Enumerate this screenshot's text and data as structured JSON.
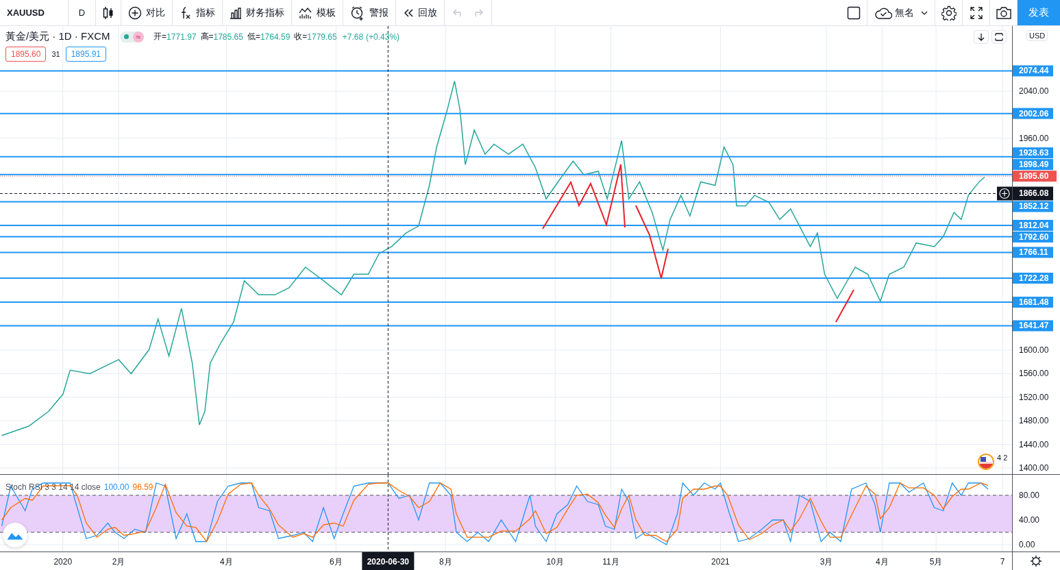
{
  "toolbar": {
    "symbol": "XAUUSD",
    "interval": "D",
    "buttons": [
      {
        "kind": "compare",
        "label": "对比"
      },
      {
        "kind": "indicators",
        "label": "指标"
      },
      {
        "kind": "financials",
        "label": "财务指标"
      },
      {
        "kind": "templates",
        "label": "模板"
      },
      {
        "kind": "alert",
        "label": "警报"
      },
      {
        "kind": "replay",
        "label": "回放"
      }
    ],
    "history_buttons": [
      {
        "kind": "undo",
        "disabled": true
      },
      {
        "kind": "redo",
        "disabled": true
      }
    ],
    "layout_name": "無名",
    "publish_label": "发表"
  },
  "legend": {
    "title": "黃金/美元 · 1D · FXCM",
    "market_open": true,
    "badge": "≈",
    "ohlc": [
      {
        "key": "开=",
        "value": "1771.97"
      },
      {
        "key": "高=",
        "value": "1785.65"
      },
      {
        "key": "低=",
        "value": "1764.59"
      },
      {
        "key": "收=",
        "value": "1779.65"
      }
    ],
    "change": "+7.68",
    "change_pct": "(+0.43%)",
    "bid": "1895.60",
    "spread": "31",
    "ask": "1895.91"
  },
  "currency": "USD",
  "event_marker": {
    "label": "4 2"
  },
  "price_pane": {
    "chart_data": {
      "type": "line",
      "grid": true,
      "xlim": [
        "2019-11-27",
        "2021-07-09"
      ],
      "ylim": [
        1389.5,
        2150.6
      ],
      "ref_lines": [
        {
          "axis": "y",
          "value": 2074.44,
          "label": "2074.44",
          "color": "#2196f3"
        },
        {
          "axis": "y",
          "value": 2002.06,
          "label": "2002.06",
          "color": "#2196f3"
        },
        {
          "axis": "y",
          "value": 1928.63,
          "label": "1928.63",
          "color": "#2196f3"
        },
        {
          "axis": "y",
          "value": 1898.49,
          "label": "1898.49",
          "color": "#2196f3"
        },
        {
          "axis": "y",
          "value": 1852.12,
          "label": "1852.12",
          "color": "#2196f3"
        },
        {
          "axis": "y",
          "value": 1812.04,
          "label": "1812.04",
          "color": "#2196f3"
        },
        {
          "axis": "y",
          "value": 1792.6,
          "label": "1792.60",
          "color": "#2196f3"
        },
        {
          "axis": "y",
          "value": 1766.11,
          "label": "1766.11",
          "color": "#2196f3"
        },
        {
          "axis": "y",
          "value": 1722.28,
          "label": "1722.28",
          "color": "#2196f3"
        },
        {
          "axis": "y",
          "value": 1681.48,
          "label": "1681.48",
          "color": "#2196f3"
        },
        {
          "axis": "y",
          "value": 1641.47,
          "label": "1641.47",
          "color": "#2196f3"
        },
        {
          "axis": "y",
          "value": 1895.6,
          "label": "1895.60",
          "color": "#ef5350"
        },
        {
          "axis": "y",
          "value": 1866.08,
          "label": "1866.08",
          "color": "#131722"
        },
        {
          "axis": "x",
          "value": "2020-06-30",
          "color": "#131722"
        }
      ],
      "x": [
        "2019-11-28",
        "2019-12-13",
        "2019-12-24",
        "2020-01-01",
        "2020-01-05",
        "2020-01-16",
        "2020-02-01",
        "2020-02-08",
        "2020-02-18",
        "2020-02-23",
        "2020-02-29",
        "2020-03-07",
        "2020-03-13",
        "2020-03-17",
        "2020-03-20",
        "2020-03-23",
        "2020-03-29",
        "2020-04-05",
        "2020-04-11",
        "2020-04-19",
        "2020-04-28",
        "2020-05-06",
        "2020-05-15",
        "2020-05-25",
        "2020-06-04",
        "2020-06-11",
        "2020-06-19",
        "2020-06-25",
        "2020-07-02",
        "2020-07-10",
        "2020-07-17",
        "2020-07-23",
        "2020-07-27",
        "2020-08-02",
        "2020-08-06",
        "2020-08-09",
        "2020-08-12",
        "2020-08-17",
        "2020-08-23",
        "2020-08-28",
        "2020-09-05",
        "2020-09-13",
        "2020-09-20",
        "2020-09-26",
        "2020-10-04",
        "2020-10-11",
        "2020-10-17",
        "2020-10-25",
        "2020-10-30",
        "2020-11-07",
        "2020-11-11",
        "2020-11-17",
        "2020-11-24",
        "2020-11-30",
        "2020-12-04",
        "2020-12-10",
        "2020-12-15",
        "2020-12-21",
        "2020-12-29",
        "2021-01-03",
        "2021-01-08",
        "2021-01-10",
        "2021-01-15",
        "2021-01-20",
        "2021-01-28",
        "2021-02-03",
        "2021-02-09",
        "2021-02-14",
        "2021-02-20",
        "2021-02-24",
        "2021-02-28",
        "2021-03-07",
        "2021-03-17",
        "2021-03-24",
        "2021-03-31",
        "2021-04-05",
        "2021-04-13",
        "2021-04-20",
        "2021-04-30",
        "2021-05-05",
        "2021-05-11",
        "2021-05-15",
        "2021-05-19",
        "2021-05-25",
        "2021-05-28"
      ],
      "series": [
        {
          "color": "#26a69a",
          "values": [
            1455,
            1471,
            1496,
            1525,
            1566,
            1560,
            1584,
            1560,
            1601,
            1653,
            1590,
            1671,
            1578,
            1473,
            1496,
            1578,
            1613,
            1648,
            1718,
            1694,
            1694,
            1706,
            1741,
            1718,
            1694,
            1729,
            1729,
            1764,
            1776,
            1799,
            1811,
            1880,
            1945,
            2009,
            2057,
            2009,
            1915,
            1974,
            1933,
            1950,
            1933,
            1950,
            1910,
            1857,
            1892,
            1921,
            1898,
            1904,
            1857,
            1956,
            1857,
            1886,
            1834,
            1770,
            1822,
            1863,
            1828,
            1886,
            1880,
            1945,
            1915,
            1845,
            1845,
            1863,
            1851,
            1822,
            1840,
            1811,
            1776,
            1799,
            1729,
            1688,
            1741,
            1729,
            1683,
            1729,
            1741,
            1782,
            1776,
            1793,
            1834,
            1822,
            1863,
            1886,
            1894
          ]
        }
      ],
      "yticks": [
        {
          "value": 2040,
          "label": "2040.00"
        },
        {
          "value": 1960,
          "label": "1960.00"
        },
        {
          "value": 1600,
          "label": "1600.00"
        },
        {
          "value": 1560,
          "label": "1560.00"
        },
        {
          "value": 1520,
          "label": "1520.00"
        },
        {
          "value": 1480,
          "label": "1480.00"
        },
        {
          "value": 1440,
          "label": "1440.00"
        },
        {
          "value": 1400,
          "label": "1400.00"
        }
      ]
    }
  },
  "indicator_pane": {
    "name": "Stoch RSI 3 3 14 14 close",
    "k_value": "100.00",
    "d_value": "96.59",
    "chart_data": {
      "type": "line",
      "grid": true,
      "xlim": [
        "2019-11-27",
        "2021-07-09"
      ],
      "ylim": [
        -11.1,
        113.3
      ],
      "bands": [
        {
          "axis": "y",
          "from": 20,
          "to": 80,
          "color": "#e9d0fb"
        }
      ],
      "ref_lines": [
        {
          "axis": "y",
          "value": 80,
          "color": "#555555"
        },
        {
          "axis": "y",
          "value": 20,
          "color": "#555555"
        },
        {
          "axis": "x",
          "value": "2020-06-30",
          "label": "2020-06-30",
          "color": "#131722"
        }
      ],
      "x": [
        "2019-11-28",
        "2019-12-03",
        "2019-12-11",
        "2019-12-15",
        "2019-12-21",
        "2020-01-05",
        "2020-01-09",
        "2020-01-14",
        "2020-01-20",
        "2020-01-26",
        "2020-01-30",
        "2020-02-04",
        "2020-02-10",
        "2020-02-16",
        "2020-02-22",
        "2020-02-27",
        "2020-03-04",
        "2020-03-10",
        "2020-03-15",
        "2020-03-21",
        "2020-03-27",
        "2020-04-02",
        "2020-04-09",
        "2020-04-15",
        "2020-04-19",
        "2020-04-25",
        "2020-04-30",
        "2020-05-08",
        "2020-05-14",
        "2020-05-19",
        "2020-05-25",
        "2020-05-31",
        "2020-06-05",
        "2020-06-11",
        "2020-06-19",
        "2020-06-25",
        "2020-06-30",
        "2020-07-06",
        "2020-07-12",
        "2020-07-17",
        "2020-07-23",
        "2020-07-29",
        "2020-08-04",
        "2020-08-07",
        "2020-08-13",
        "2020-08-19",
        "2020-08-25",
        "2020-09-01",
        "2020-09-09",
        "2020-09-17",
        "2020-09-20",
        "2020-09-26",
        "2020-10-02",
        "2020-10-08",
        "2020-10-13",
        "2020-10-19",
        "2020-10-25",
        "2020-10-29",
        "2020-11-03",
        "2020-11-07",
        "2020-11-11",
        "2020-11-15",
        "2020-11-20",
        "2020-11-26",
        "2020-12-02",
        "2020-12-08",
        "2020-12-11",
        "2020-12-17",
        "2020-12-23",
        "2020-12-29",
        "2021-01-01",
        "2021-01-05",
        "2021-01-11",
        "2021-01-17",
        "2021-01-24",
        "2021-01-30",
        "2021-02-05",
        "2021-02-09",
        "2021-02-14",
        "2021-02-20",
        "2021-02-26",
        "2021-03-03",
        "2021-03-09",
        "2021-03-15",
        "2021-03-23",
        "2021-03-28",
        "2021-03-31",
        "2021-04-05",
        "2021-04-11",
        "2021-04-16",
        "2021-04-24",
        "2021-04-30",
        "2021-05-05",
        "2021-05-10",
        "2021-05-15",
        "2021-05-19",
        "2021-05-26",
        "2021-05-30"
      ],
      "series": [
        {
          "color": "#2196f3",
          "values": [
            30,
            95,
            55,
            90,
            100,
            100,
            60,
            10,
            15,
            35,
            20,
            10,
            25,
            20,
            100,
            95,
            10,
            50,
            5,
            5,
            70,
            95,
            100,
            100,
            60,
            55,
            10,
            15,
            20,
            5,
            60,
            10,
            50,
            95,
            100,
            100,
            100,
            75,
            80,
            40,
            100,
            100,
            80,
            20,
            5,
            20,
            5,
            40,
            5,
            80,
            30,
            5,
            50,
            65,
            95,
            70,
            65,
            30,
            25,
            90,
            70,
            10,
            20,
            10,
            0,
            50,
            100,
            80,
            100,
            90,
            100,
            60,
            5,
            10,
            25,
            40,
            40,
            5,
            80,
            70,
            5,
            20,
            5,
            90,
            100,
            65,
            20,
            100,
            100,
            85,
            100,
            60,
            55,
            100,
            80,
            100,
            100,
            90
          ]
        },
        {
          "color": "#ff6d00",
          "values": [
            40,
            60,
            75,
            72,
            95,
            96,
            80,
            35,
            12,
            25,
            28,
            15,
            18,
            22,
            60,
            98,
            52,
            30,
            28,
            5,
            38,
            82,
            98,
            100,
            80,
            58,
            32,
            12,
            18,
            12,
            32,
            35,
            30,
            72,
            98,
            100,
            100,
            88,
            78,
            60,
            70,
            100,
            90,
            50,
            12,
            12,
            12,
            22,
            22,
            42,
            55,
            18,
            28,
            58,
            80,
            82,
            68,
            48,
            28,
            58,
            80,
            40,
            15,
            15,
            5,
            25,
            75,
            90,
            90,
            95,
            95,
            80,
            32,
            8,
            18,
            32,
            40,
            22,
            42,
            75,
            38,
            12,
            12,
            48,
            95,
            82,
            42,
            60,
            100,
            92,
            92,
            80,
            58,
            78,
            90,
            90,
            100,
            96
          ]
        }
      ],
      "yticks": [
        {
          "value": 80,
          "label": "80.00"
        },
        {
          "value": 40,
          "label": "40.00"
        },
        {
          "value": 0,
          "label": "0.00"
        }
      ],
      "xticks": [
        {
          "value": "2020-01-01",
          "label": "2020"
        },
        {
          "value": "2020-02-01",
          "label": "2月"
        },
        {
          "value": "2020-04-01",
          "label": "4月"
        },
        {
          "value": "2020-06-01",
          "label": "6月"
        },
        {
          "value": "2020-08-01",
          "label": "8月"
        },
        {
          "value": "2020-10-01",
          "label": "10月"
        },
        {
          "value": "2020-11-01",
          "label": "11月"
        },
        {
          "value": "2021-01-01",
          "label": "2021"
        },
        {
          "value": "2021-03-01",
          "label": "3月"
        },
        {
          "value": "2021-04-01",
          "label": "4月"
        },
        {
          "value": "2021-05-01",
          "label": "5月"
        },
        {
          "value": "2021-06-07",
          "label": "7"
        }
      ]
    }
  }
}
